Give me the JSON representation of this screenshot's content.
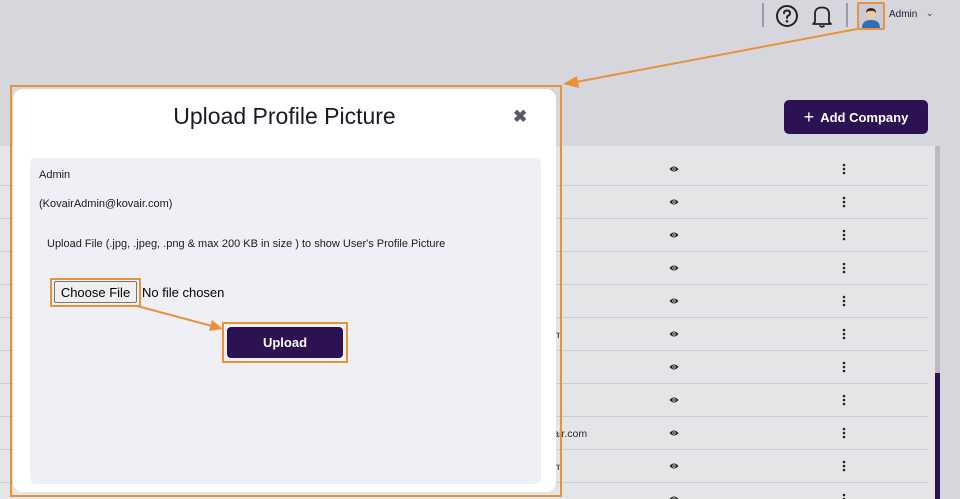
{
  "header": {
    "help_icon": "help-circle-icon",
    "bell_icon": "bell-icon",
    "user_label": "Admin",
    "dropdown_glyph": "⌄"
  },
  "toolbar": {
    "add_company_label": "Add Company",
    "add_icon": "+"
  },
  "table": {
    "visible_email_fragments": [
      "om",
      "vair.com",
      "om"
    ]
  },
  "modal": {
    "title": "Upload Profile Picture",
    "close_glyph": "✖",
    "user_name": "Admin",
    "user_email": "(KovairAdmin@kovair.com)",
    "upload_note": "Upload File (.jpg, .jpeg, .png & max 200 KB in size ) to show User's Profile Picture",
    "choose_file_label": "Choose File",
    "no_file_text": "No file chosen",
    "upload_label": "Upload"
  },
  "colors": {
    "brand": "#2c1252",
    "highlight": "#e8923a",
    "panel": "#eff0f6",
    "background": "#d6d7dd"
  }
}
